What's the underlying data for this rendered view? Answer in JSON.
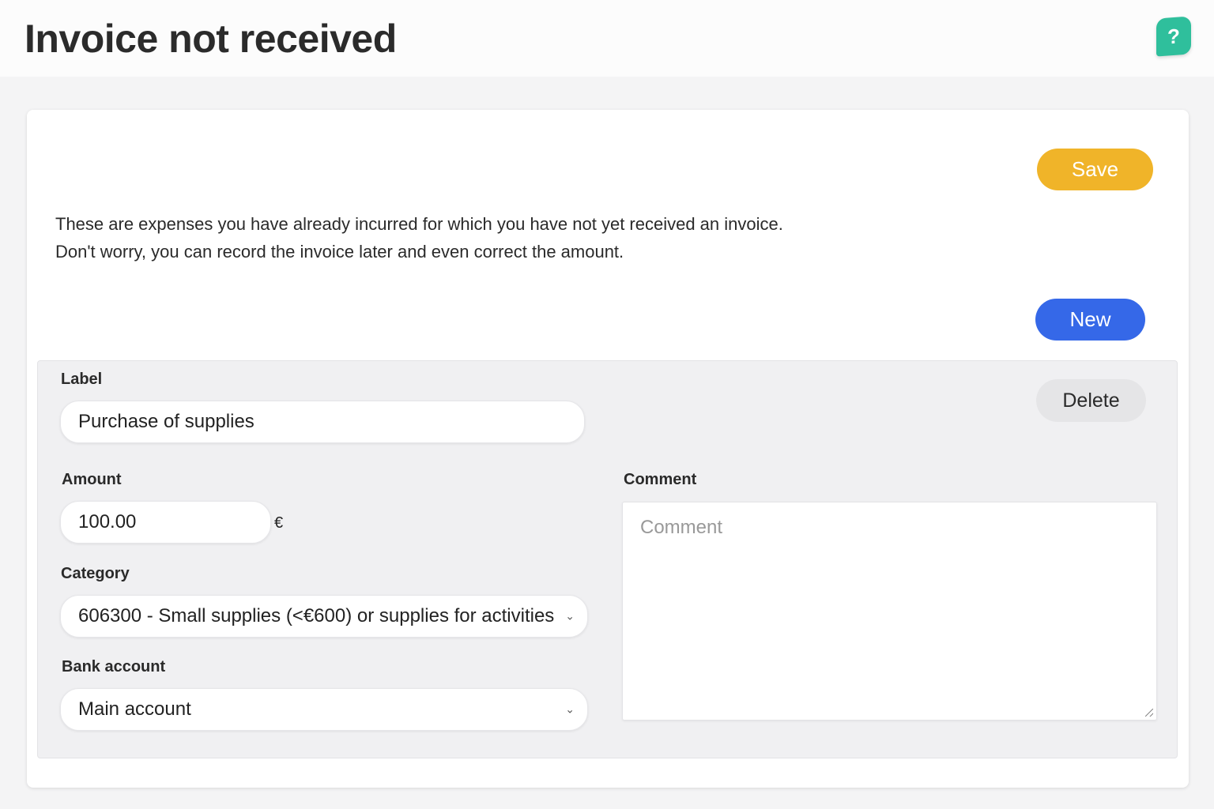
{
  "header": {
    "title": "Invoice not received",
    "help_label": "?"
  },
  "toolbar": {
    "save_label": "Save",
    "new_label": "New"
  },
  "intro": {
    "line1": "These are expenses you have already incurred for which you have not yet received an invoice.",
    "line2": "Don't worry, you can record the invoice later and even correct the amount."
  },
  "entry": {
    "label_title": "Label",
    "label_value": "Purchase of supplies",
    "delete_label": "Delete",
    "amount_title": "Amount",
    "amount_value": "100.00",
    "currency": "€",
    "category_title": "Category",
    "category_value": "606300 - Small supplies (<€600) or supplies for activities",
    "bank_title": "Bank account",
    "bank_value": "Main account",
    "comment_title": "Comment",
    "comment_placeholder": "Comment"
  },
  "colors": {
    "save": "#f0b429",
    "new": "#3568e8",
    "help": "#2fbf9c"
  }
}
